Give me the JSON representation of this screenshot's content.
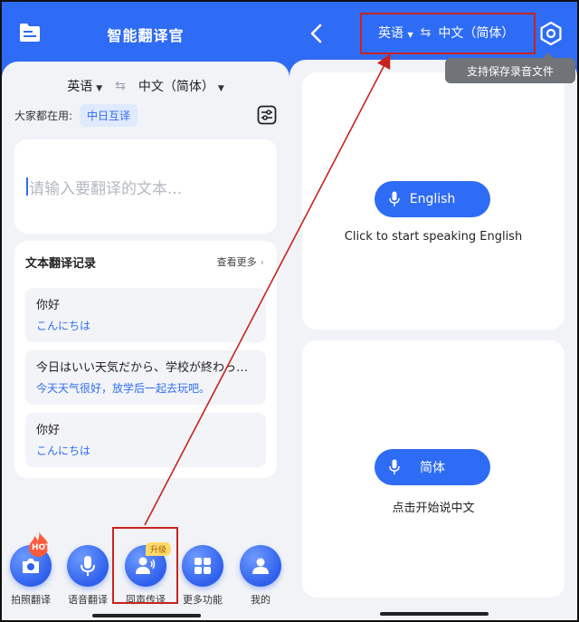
{
  "left": {
    "title": "智能翻译官",
    "source_lang": "英语",
    "target_lang": "中文（简体）",
    "popular_label": "大家都在用:",
    "popular_pill": "中日互译",
    "input_placeholder": "请输入要翻译的文本...",
    "history": {
      "title": "文本翻译记录",
      "more": "查看更多",
      "items": [
        {
          "source": "你好",
          "target": "こんにちは"
        },
        {
          "source": "今日はいい天気だから、学校が終わったら一緒に遊びに行こう。",
          "target": "今天天气很好，放学后一起去玩吧。"
        },
        {
          "source": "你好",
          "target": "こんにちは"
        }
      ]
    },
    "tabs": [
      {
        "label": "拍照翻译",
        "icon": "camera-icon",
        "badge": "HOT"
      },
      {
        "label": "语音翻译",
        "icon": "microphone-icon"
      },
      {
        "label": "同声传译",
        "icon": "simultaneous-interpret-icon",
        "badge": "升级"
      },
      {
        "label": "更多功能",
        "icon": "grid-icon"
      },
      {
        "label": "我的",
        "icon": "user-icon"
      }
    ]
  },
  "right": {
    "source_lang": "英语",
    "target_lang": "中文（简体）",
    "tooltip": "支持保存录音文件",
    "cards": [
      {
        "button": "English",
        "hint": "Click to start speaking English"
      },
      {
        "button": "简体",
        "hint": "点击开始说中文"
      }
    ]
  },
  "colors": {
    "brand_blue": "#2f6cf5",
    "annotation_red": "#c8231f",
    "background": "#f1f3f7"
  }
}
